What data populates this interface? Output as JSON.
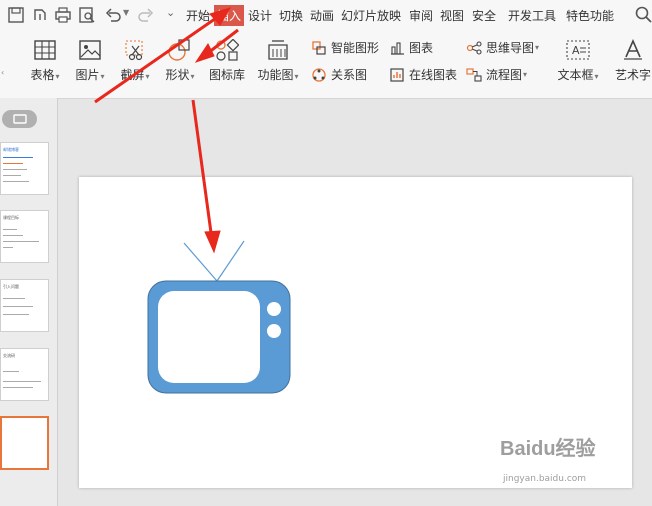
{
  "menubar": {
    "tabs": [
      {
        "label": "开始"
      },
      {
        "label": "插入"
      },
      {
        "label": "设计"
      },
      {
        "label": "切换"
      },
      {
        "label": "动画"
      },
      {
        "label": "幻灯片放映"
      },
      {
        "label": "审阅"
      },
      {
        "label": "视图"
      },
      {
        "label": "安全"
      },
      {
        "label": "开发工具"
      },
      {
        "label": "特色功能"
      }
    ],
    "active_tab": "插入"
  },
  "ribbon": {
    "table": "表格",
    "picture": "图片",
    "screenshot": "截屏",
    "shape": "形状",
    "icon_library": "图标库",
    "function_chart": "功能图",
    "smart_graphic": "智能图形",
    "chart": "图表",
    "relation_chart": "关系图",
    "online_chart": "在线图表",
    "mind_map": "思维导图",
    "flowchart": "流程图",
    "textbox": "文本框",
    "art_text": "艺术字"
  },
  "thumbnails": [
    {
      "title": "邮储博客"
    },
    {
      "title": "课程目标"
    },
    {
      "title": "引入问题"
    },
    {
      "title": "交流研"
    },
    {
      "title": ""
    }
  ],
  "watermark": {
    "brand": "Baidu经验",
    "url": "jingyan.baidu.com"
  },
  "colors": {
    "accent": "#d9584a",
    "shape_fill": "#5b9bd5",
    "arrow": "#e8271d",
    "selected_thumb": "#e8763a"
  }
}
